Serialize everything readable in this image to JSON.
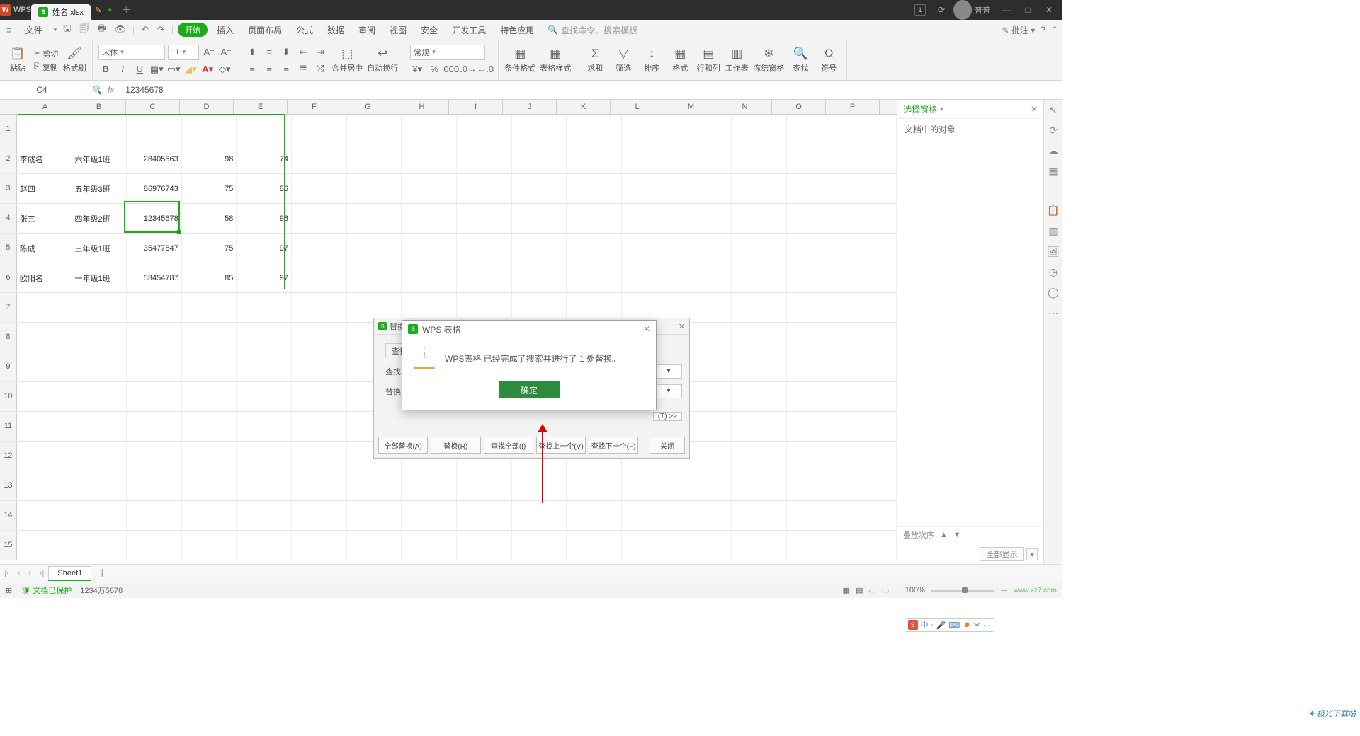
{
  "titlebar": {
    "app": "WPS",
    "file": "姓名.xlsx",
    "user": "普普"
  },
  "menubar": {
    "file": "文件",
    "tabs": [
      "开始",
      "插入",
      "页面布局",
      "公式",
      "数据",
      "审阅",
      "视图",
      "安全",
      "开发工具",
      "特色应用"
    ],
    "search_ph": "查找命令、搜索模板",
    "annotate": "批注"
  },
  "ribbon": {
    "paste": "粘贴",
    "cut": "剪切",
    "copy": "复制",
    "fmtpaint": "格式刷",
    "font": "宋体",
    "size": "11",
    "merge": "合并居中",
    "wrap": "自动换行",
    "numfmt": "常规",
    "condfmt": "条件格式",
    "tblstyle": "表格样式",
    "sum": "求和",
    "filter": "筛选",
    "sort": "排序",
    "format": "格式",
    "rowcol": "行和列",
    "worksheet": "工作表",
    "freeze": "冻结窗格",
    "find": "查找",
    "symbol": "符号"
  },
  "fx": {
    "cell": "C4",
    "value": "12345678"
  },
  "cols": [
    "A",
    "B",
    "C",
    "D",
    "E",
    "F",
    "G",
    "H",
    "I",
    "J",
    "K",
    "L",
    "M",
    "N",
    "O",
    "P"
  ],
  "data": [
    [
      "李成名",
      "六年级1班",
      "28405563",
      "98",
      "74"
    ],
    [
      "赵四",
      "五年级3班",
      "86976743",
      "75",
      "86"
    ],
    [
      "张三",
      "四年级2班",
      "12345678",
      "58",
      "96"
    ],
    [
      "陈成",
      "三年级1班",
      "35477847",
      "75",
      "97"
    ],
    [
      "欧阳名",
      "一年级1班",
      "53454787",
      "85",
      "97"
    ]
  ],
  "pane": {
    "title": "选择窗格",
    "line": "文档中的对象",
    "order": "叠放次序",
    "showall": "全部显示"
  },
  "dialog_find": {
    "title": "替换",
    "t_find": "查找(",
    "t_findwhat": "查找内",
    "t_replacewith": "替换为",
    "more": "(T) >>",
    "btns": [
      "全部替换(A)",
      "替换(R)",
      "查找全部(I)",
      "查找上一个(V)",
      "查找下一个(F)",
      "关闭"
    ]
  },
  "dialog_msg": {
    "title": "WPS 表格",
    "text": "WPS表格 已经完成了搜索并进行了 1 处替换。",
    "ok": "确定"
  },
  "sheet": {
    "name": "Sheet1"
  },
  "status": {
    "protected": "文档已保护",
    "stats": "1234万5678",
    "zoom": "100%"
  },
  "watermark": {
    "a": "极光下载站",
    "b": "www.xz7.com"
  },
  "ime": "中"
}
